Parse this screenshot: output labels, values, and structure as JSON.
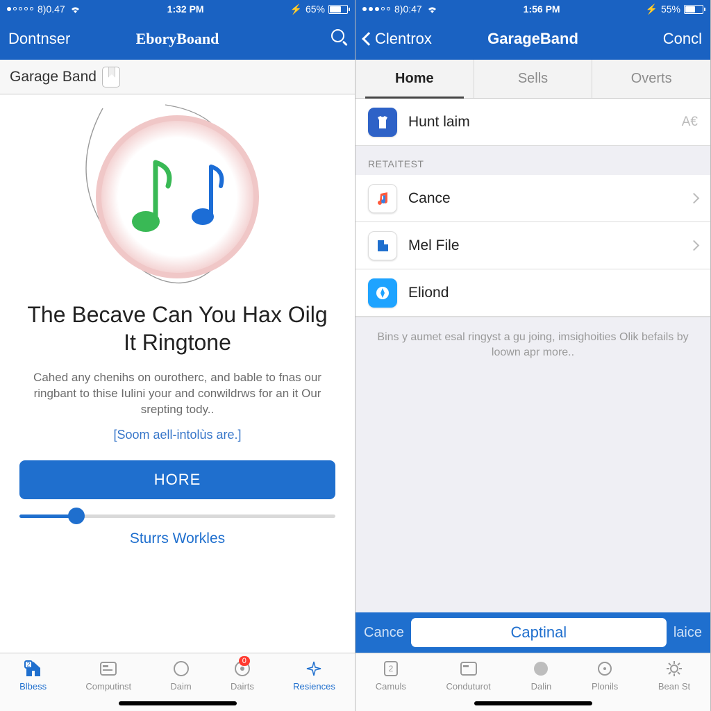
{
  "left": {
    "status": {
      "carrier": "8)0.47",
      "time": "1:32 PM",
      "battery": "65%"
    },
    "nav": {
      "back": "Dontnser",
      "title": "EboryBoand"
    },
    "subheader": "Garage Band",
    "headline": "The Becave Can You Hax Oilg It Ringtone",
    "description": "Cahed any chenihs on ourotherc, and bable to fnas our ringbant to thise Iulini your and conwildrws for an it Our srepting tody..",
    "linkline": "[Soom aell-intolùs are.]",
    "primary_button": "HORE",
    "secondary_link": "Sturrs Workles",
    "tabs": [
      {
        "label": "Blbess",
        "active": true
      },
      {
        "label": "Computinst"
      },
      {
        "label": "Daim"
      },
      {
        "label": "Dairts",
        "badge": "0"
      },
      {
        "label": "Resiences"
      }
    ]
  },
  "right": {
    "status": {
      "carrier": "8)0:47",
      "time": "1:56 PM",
      "battery": "55%"
    },
    "nav": {
      "back": "Clentrox",
      "title": "GarageBand",
      "action": "Concl"
    },
    "segments": [
      {
        "label": "Home",
        "active": true
      },
      {
        "label": "Sells"
      },
      {
        "label": "Overts"
      }
    ],
    "featured": {
      "label": "Hunt laim",
      "meta": "A€"
    },
    "section_header": "RETAITEST",
    "items": [
      {
        "label": "Cance"
      },
      {
        "label": "Mel File"
      },
      {
        "label": "Eliond"
      }
    ],
    "footer_note": "Bins y aumet esal ringyst a gu joing, imsighoities Olik befails by loown apr more..",
    "toolbar": {
      "cancel": "Cance",
      "main": "Captinal",
      "alt": "laice"
    },
    "tabs": [
      {
        "label": "Camuls"
      },
      {
        "label": "Conduturot"
      },
      {
        "label": "Dalin"
      },
      {
        "label": "Plonils"
      },
      {
        "label": "Bean St"
      }
    ]
  }
}
